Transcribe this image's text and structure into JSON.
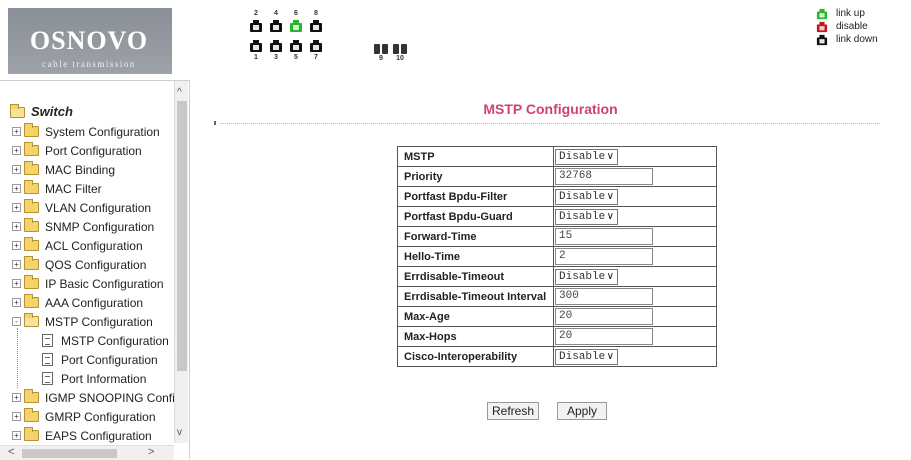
{
  "header": {
    "logo_title": "OSNOVO",
    "logo_subtitle": "cable transmission",
    "ports_top": [
      {
        "num": "2",
        "status": "link down"
      },
      {
        "num": "4",
        "status": "link down"
      },
      {
        "num": "6",
        "status": "link up"
      },
      {
        "num": "8",
        "status": "link down"
      }
    ],
    "ports_bottom": [
      {
        "num": "1",
        "status": "link down"
      },
      {
        "num": "3",
        "status": "link down"
      },
      {
        "num": "5",
        "status": "link down"
      },
      {
        "num": "7",
        "status": "link down"
      }
    ],
    "fiber_ports": [
      "9",
      "10"
    ],
    "legend": {
      "link_up": "link up",
      "disable": "disable",
      "link_down": "link down"
    },
    "colors": {
      "link_up": "#2bb52b",
      "disable": "#c01818",
      "link_down": "#111111"
    }
  },
  "sidebar": {
    "root": "Switch",
    "items": [
      {
        "label": "System Configuration",
        "expander": "+"
      },
      {
        "label": "Port Configuration",
        "expander": "+"
      },
      {
        "label": "MAC Binding",
        "expander": "+"
      },
      {
        "label": "MAC Filter",
        "expander": "+"
      },
      {
        "label": "VLAN Configuration",
        "expander": "+"
      },
      {
        "label": "SNMP Configuration",
        "expander": "+"
      },
      {
        "label": "ACL Configuration",
        "expander": "+"
      },
      {
        "label": "QOS Configuration",
        "expander": "+"
      },
      {
        "label": "IP Basic Configuration",
        "expander": "+"
      },
      {
        "label": "AAA Configuration",
        "expander": "+"
      },
      {
        "label": "MSTP Configuration",
        "expander": "-"
      },
      {
        "label": "IGMP SNOOPING Confi",
        "expander": "+"
      },
      {
        "label": "GMRP Configuration",
        "expander": "+"
      },
      {
        "label": "EAPS Configuration",
        "expander": "+"
      }
    ],
    "mstp_children": [
      "MSTP Configuration",
      "Port Configuration",
      "Port Information"
    ]
  },
  "main": {
    "title": "MSTP Configuration",
    "title_color": "#d2416f",
    "rows": [
      {
        "label": "MSTP",
        "type": "select",
        "value": "Disable"
      },
      {
        "label": "Priority",
        "type": "input",
        "value": "32768"
      },
      {
        "label": "Portfast Bpdu-Filter",
        "type": "select",
        "value": "Disable"
      },
      {
        "label": "Portfast Bpdu-Guard",
        "type": "select",
        "value": "Disable"
      },
      {
        "label": "Forward-Time",
        "type": "input",
        "value": "15"
      },
      {
        "label": "Hello-Time",
        "type": "input",
        "value": "2"
      },
      {
        "label": "Errdisable-Timeout",
        "type": "select",
        "value": "Disable"
      },
      {
        "label": "Errdisable-Timeout Interval",
        "type": "input",
        "value": "300"
      },
      {
        "label": "Max-Age",
        "type": "input",
        "value": "20"
      },
      {
        "label": "Max-Hops",
        "type": "input",
        "value": "20"
      },
      {
        "label": "Cisco-Interoperability",
        "type": "select",
        "value": "Disable"
      }
    ],
    "refresh_label": "Refresh",
    "apply_label": "Apply"
  }
}
